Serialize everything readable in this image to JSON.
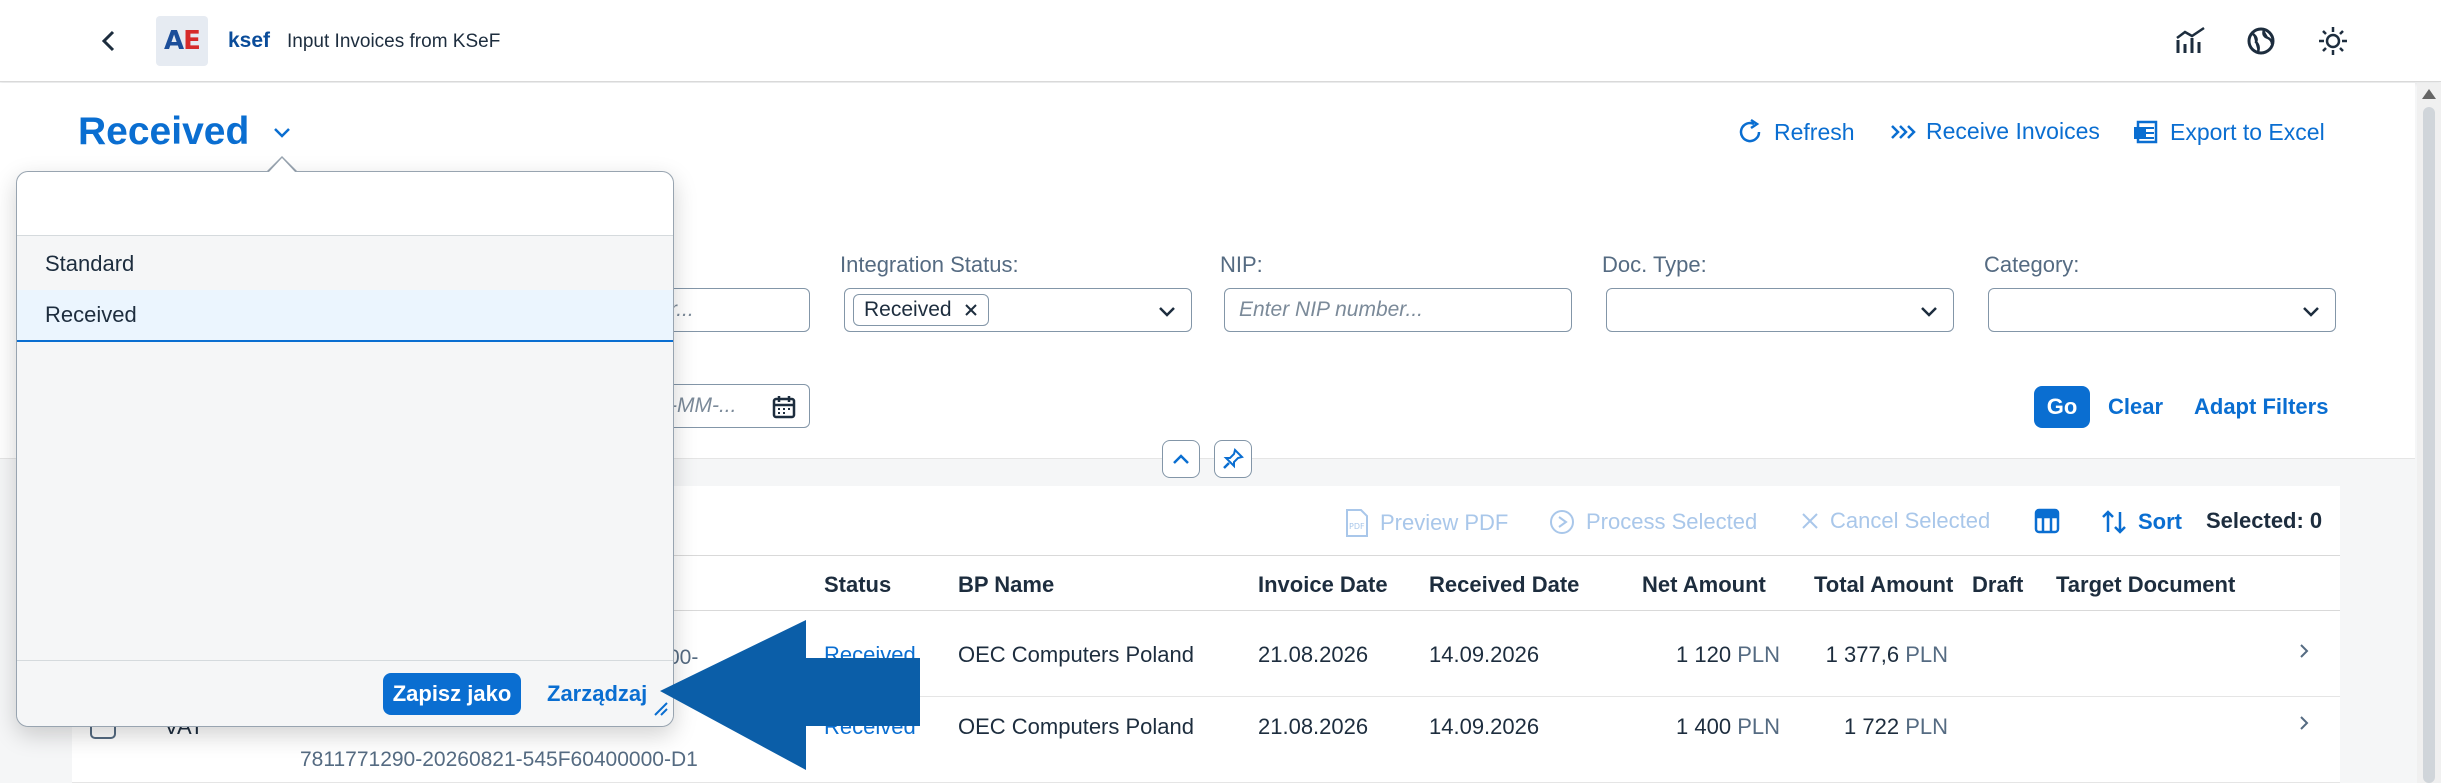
{
  "shell": {
    "app_name": "ksef",
    "app_title": "Input Invoices from KSeF",
    "logo_a": "A",
    "logo_e": "E"
  },
  "header": {
    "variant_title": "Received",
    "actions": {
      "refresh": "Refresh",
      "receive": "Receive Invoices",
      "export": "Export to Excel"
    }
  },
  "filters": {
    "left_partial_placeholder": "r...",
    "integration_status_label": "Integration Status:",
    "integration_status_token": "Received",
    "nip_label": "NIP:",
    "nip_placeholder": "Enter NIP number...",
    "doc_type_label": "Doc. Type:",
    "category_label": "Category:",
    "date_partial_placeholder": "-MM-...",
    "go": "Go",
    "clear": "Clear",
    "adapt": "Adapt Filters"
  },
  "toolbar": {
    "preview_pdf": "Preview PDF",
    "process_selected": "Process Selected",
    "cancel_selected": "Cancel Selected",
    "sort": "Sort",
    "selected": "Selected: 0"
  },
  "table": {
    "columns": [
      "Status",
      "BP Name",
      "Invoice Date",
      "Received Date",
      "Net Amount",
      "Total Amount",
      "Draft",
      "Target Document"
    ],
    "rows": [
      {
        "partial_id": "00-",
        "status": "Received",
        "bp_name": "OEC Computers Poland",
        "invoice_date": "21.08.2026",
        "received_date": "14.09.2026",
        "net_amount": "1 120",
        "net_currency": "PLN",
        "total_amount": "1 377,6",
        "total_currency": "PLN"
      },
      {
        "type": "VAT",
        "ksef_id": "7811771290-20260821-545F60400000-D1",
        "status": "Received",
        "bp_name": "OEC Computers Poland",
        "invoice_date": "21.08.2026",
        "received_date": "14.09.2026",
        "net_amount": "1 400",
        "net_currency": "PLN",
        "total_amount": "1 722",
        "total_currency": "PLN"
      }
    ]
  },
  "variant_popover": {
    "search_value": "",
    "items": [
      "Standard",
      "Received"
    ],
    "selected_index": 1,
    "save_as": "Zapisz jako",
    "manage": "Zarządzaj"
  },
  "colors": {
    "accent": "#0a6ed1",
    "annotation_arrow": "#0b5ea8"
  }
}
